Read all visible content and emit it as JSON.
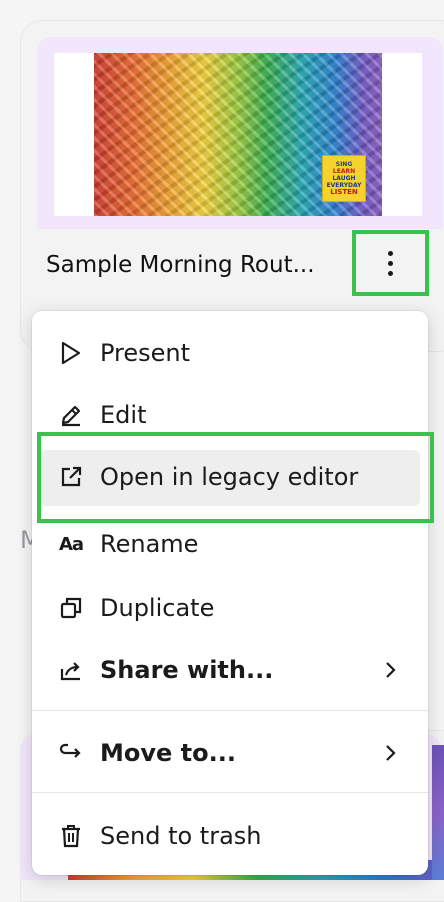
{
  "card": {
    "title": "Sample Morning Rout...",
    "badge_lines": [
      "SING",
      "LEARN",
      "LAUGH",
      "EVERYDAY",
      "LISTEN"
    ]
  },
  "section_peek": "M",
  "menu": {
    "items": [
      {
        "label": "Present",
        "icon": "play-icon"
      },
      {
        "label": "Edit",
        "icon": "pencil-icon"
      },
      {
        "label": "Open in legacy editor",
        "icon": "external-link-icon"
      },
      {
        "label": "Rename",
        "icon_text": "Aa",
        "icon": "rename-icon"
      },
      {
        "label": "Duplicate",
        "icon": "duplicate-icon"
      },
      {
        "label": "Share with...",
        "icon": "share-icon"
      },
      {
        "label": "Move to...",
        "icon": "move-icon"
      },
      {
        "label": "Send to trash",
        "icon": "trash-icon"
      }
    ]
  },
  "colors": {
    "highlight_outline": "#3bc24d",
    "thumb_frame": "#f1e6fb",
    "hover_bg": "#eeeeef"
  }
}
